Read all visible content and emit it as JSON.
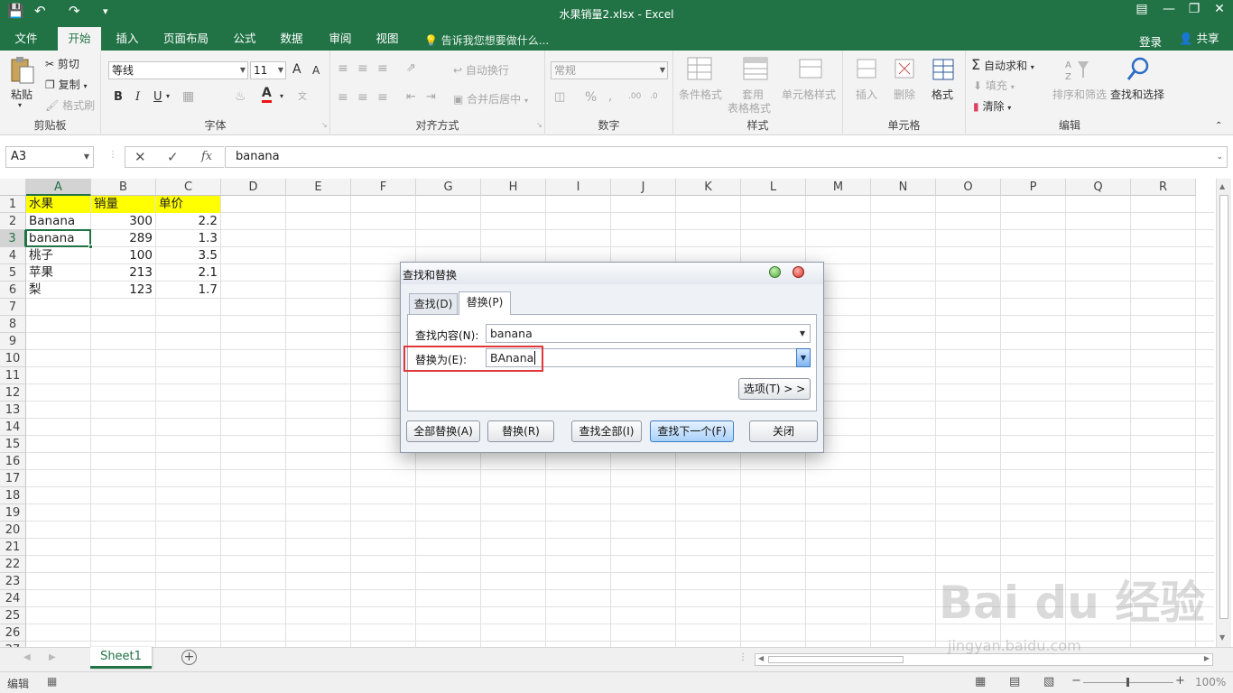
{
  "window": {
    "title": "水果销量2.xlsx - Excel"
  },
  "ribbon_tabs": [
    {
      "label": "文件",
      "active": false
    },
    {
      "label": "开始",
      "active": true
    },
    {
      "label": "插入",
      "active": false
    },
    {
      "label": "页面布局",
      "active": false
    },
    {
      "label": "公式",
      "active": false
    },
    {
      "label": "数据",
      "active": false
    },
    {
      "label": "审阅",
      "active": false
    },
    {
      "label": "视图",
      "active": false
    }
  ],
  "tell_me": "告诉我您想要做什么...",
  "account": {
    "login": "登录",
    "share": "共享"
  },
  "ribbon": {
    "clipboard": {
      "paste": "粘贴",
      "cut": "剪切",
      "copy": "复制",
      "format_painter": "格式刷",
      "label": "剪贴板"
    },
    "font": {
      "name": "等线",
      "size": "11",
      "grow": "A",
      "shrink": "A",
      "bold": "B",
      "italic": "I",
      "underline": "U",
      "label": "字体"
    },
    "alignment": {
      "wrap": "自动换行",
      "merge": "合并后居中",
      "label": "对齐方式"
    },
    "number": {
      "format": "常规",
      "label": "数字"
    },
    "styles": {
      "conditional": "条件格式",
      "table_1": "套用",
      "table_2": "表格格式",
      "cell_styles": "单元格样式",
      "label": "样式"
    },
    "cells": {
      "insert": "插入",
      "delete": "删除",
      "format": "格式",
      "label": "单元格"
    },
    "editing": {
      "autosum": "自动求和",
      "fill": "填充",
      "clear": "清除",
      "sort": "排序和筛选",
      "find": "查找和选择",
      "label": "编辑"
    }
  },
  "formula_bar": {
    "name_box": "A3",
    "content": "banana"
  },
  "columns": [
    "A",
    "B",
    "C",
    "D",
    "E",
    "F",
    "G",
    "H",
    "I",
    "J",
    "K",
    "L",
    "M",
    "N",
    "O",
    "P",
    "Q",
    "R"
  ],
  "rows": [
    "1",
    "2",
    "3",
    "4",
    "5",
    "6",
    "7",
    "8",
    "9",
    "10",
    "11",
    "12",
    "13",
    "14",
    "15",
    "16",
    "17",
    "18",
    "19",
    "20",
    "21",
    "22",
    "23",
    "24",
    "25",
    "26",
    "27"
  ],
  "cells": {
    "header": [
      "水果",
      "销量",
      "单价"
    ],
    "data": [
      [
        "Banana",
        "300",
        "2.2"
      ],
      [
        "banana",
        "289",
        "1.3"
      ],
      [
        "桃子",
        "100",
        "3.5"
      ],
      [
        "苹果",
        "213",
        "2.1"
      ],
      [
        "梨",
        "123",
        "1.7"
      ]
    ]
  },
  "sheet": {
    "name": "Sheet1"
  },
  "status": {
    "mode": "编辑",
    "zoom": "100%"
  },
  "dialog": {
    "title": "查找和替换",
    "tabs": [
      "查找(D)",
      "替换(P)"
    ],
    "find_label": "查找内容(N):",
    "find_value": "banana",
    "replace_label": "替换为(E):",
    "replace_value": "BAnana",
    "options_button": "选项(T) > >",
    "buttons": {
      "replace_all": "全部替换(A)",
      "replace": "替换(R)",
      "find_all": "查找全部(I)",
      "find_next": "查找下一个(F)",
      "close": "关闭"
    }
  },
  "watermark": {
    "logo": "Bai du 经验",
    "url": "jingyan.baidu.com"
  },
  "colors": {
    "excel_green": "#217346",
    "highlight": "#ffff00",
    "annotation_red": "#e0373a"
  }
}
